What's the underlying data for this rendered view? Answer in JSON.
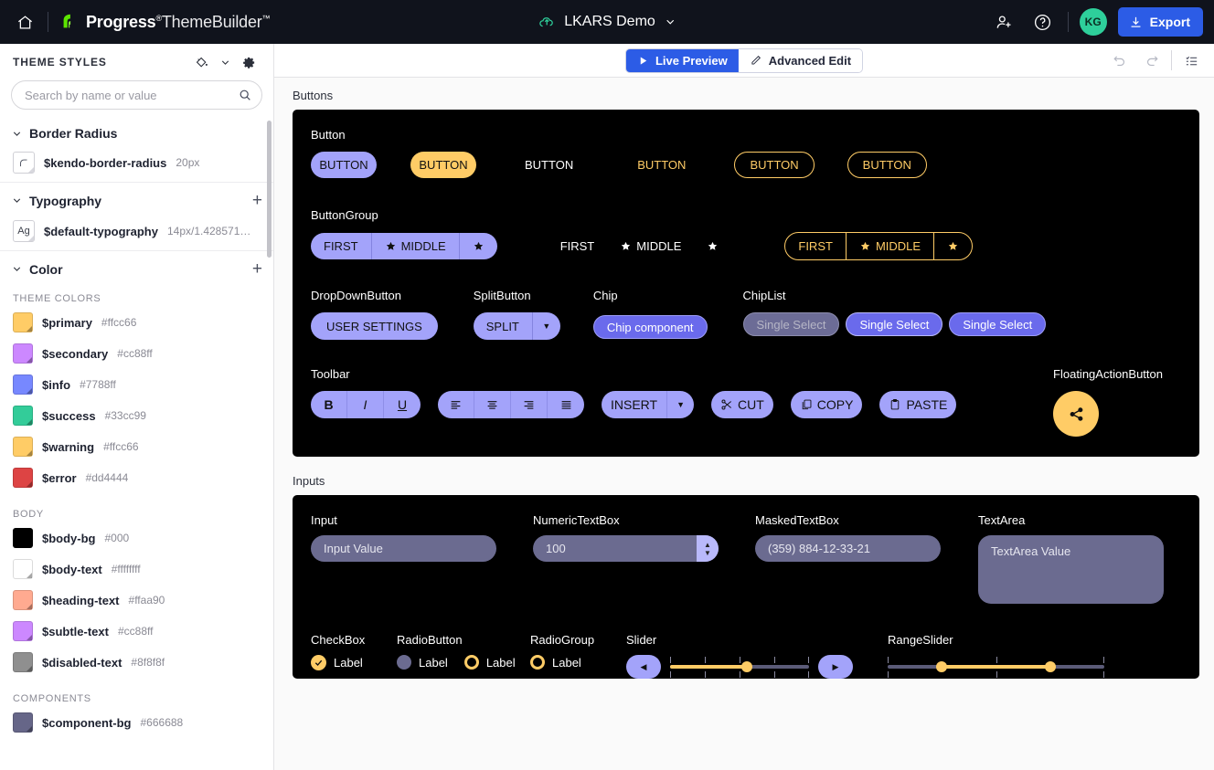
{
  "topbar": {
    "home_icon": "home-icon",
    "brand_bold": "Progress",
    "brand_light": "ThemeBuilder",
    "brand_tm": "™",
    "brand_reg": "®",
    "doc_title": "LKARS Demo",
    "cloud_icon": "cloud-upload-icon",
    "chevron_icon": "chevron-down-icon",
    "invite_icon": "add-user-icon",
    "help_icon": "help-circle-icon",
    "avatar_initials": "KG",
    "avatar_color": "#2ecf9b",
    "export_label": "Export",
    "export_icon": "download-icon",
    "export_color": "#2c5ce6"
  },
  "sidebar": {
    "title": "THEME STYLES",
    "paint_icon": "paint-bucket-icon",
    "chevron_icon": "chevron-down-icon",
    "gear_icon": "gear-icon",
    "search": {
      "placeholder": "Search by name or value",
      "value": "",
      "icon": "search-icon"
    },
    "sections": [
      {
        "name": "Border Radius",
        "has_plus": false,
        "tokens": [
          {
            "name": "$kendo-border-radius",
            "value": "20px",
            "swatch": "radius-preview"
          }
        ]
      },
      {
        "name": "Typography",
        "has_plus": true,
        "tokens": [
          {
            "name": "$default-typography",
            "value": "14px/1.428571…",
            "swatch": "Ag"
          }
        ]
      },
      {
        "name": "Color",
        "has_plus": true,
        "groups": [
          {
            "label": "THEME COLORS",
            "tokens": [
              {
                "name": "$primary",
                "value": "#ffcc66",
                "color": "#ffcc66"
              },
              {
                "name": "$secondary",
                "value": "#cc88ff",
                "color": "#cc88ff"
              },
              {
                "name": "$info",
                "value": "#7788ff",
                "color": "#7788ff"
              },
              {
                "name": "$success",
                "value": "#33cc99",
                "color": "#33cc99"
              },
              {
                "name": "$warning",
                "value": "#ffcc66",
                "color": "#ffcc66"
              },
              {
                "name": "$error",
                "value": "#dd4444",
                "color": "#dd4444"
              }
            ]
          },
          {
            "label": "BODY",
            "tokens": [
              {
                "name": "$body-bg",
                "value": "#000",
                "color": "#000000"
              },
              {
                "name": "$body-text",
                "value": "#ffffffff",
                "color": "#ffffff"
              },
              {
                "name": "$heading-text",
                "value": "#ffaa90",
                "color": "#ffaa90"
              },
              {
                "name": "$subtle-text",
                "value": "#cc88ff",
                "color": "#cc88ff"
              },
              {
                "name": "$disabled-text",
                "value": "#8f8f8f",
                "color": "#8f8f8f"
              }
            ]
          },
          {
            "label": "COMPONENTS",
            "tokens": [
              {
                "name": "$component-bg",
                "value": "#666688",
                "color": "#666688"
              }
            ]
          }
        ]
      }
    ]
  },
  "preview_bar": {
    "live_preview": "Live Preview",
    "live_preview_icon": "play-icon",
    "advanced_edit": "Advanced Edit",
    "advanced_edit_icon": "pencil-icon",
    "undo_icon": "undo-icon",
    "redo_icon": "redo-icon",
    "list_icon": "checklist-icon"
  },
  "canvas": {
    "buttons_panel": {
      "label": "Buttons",
      "button_row": {
        "label": "Button",
        "items": [
          {
            "text": "BUTTON",
            "variant": "primary"
          },
          {
            "text": "BUTTON",
            "variant": "warn"
          },
          {
            "text": "BUTTON",
            "variant": "flat"
          },
          {
            "text": "BUTTON",
            "variant": "link"
          },
          {
            "text": "BUTTON",
            "variant": "outline"
          },
          {
            "text": "BUTTON",
            "variant": "outline"
          }
        ]
      },
      "buttongroup_row": {
        "label": "ButtonGroup",
        "first": "FIRST",
        "middle": "MIDDLE",
        "star_icon": "star-icon"
      },
      "dropdownbutton": {
        "label": "DropDownButton",
        "text": "USER SETTINGS"
      },
      "splitbutton": {
        "label": "SplitButton",
        "text": "SPLIT",
        "arrow_icon": "caret-down-icon"
      },
      "chip": {
        "label": "Chip",
        "text": "Chip component"
      },
      "chiplist": {
        "label": "ChipList",
        "items": [
          {
            "text": "Single Select",
            "state": "disabled"
          },
          {
            "text": "Single Select",
            "state": "selected"
          },
          {
            "text": "Single Select",
            "state": "normal"
          }
        ]
      },
      "toolbar": {
        "label": "Toolbar",
        "bold": "B",
        "italic": "I",
        "underline": "U",
        "align_left_icon": "align-left-icon",
        "align_center_icon": "align-center-icon",
        "align_right_icon": "align-right-icon",
        "align_justify_icon": "align-justify-icon",
        "insert": "INSERT",
        "insert_arrow_icon": "caret-down-icon",
        "cut": "CUT",
        "cut_icon": "scissors-icon",
        "copy": "COPY",
        "copy_icon": "copy-icon",
        "paste": "PASTE",
        "paste_icon": "clipboard-icon"
      },
      "fab": {
        "label": "FloatingActionButton",
        "icon": "share-icon",
        "color": "#ffcc66"
      }
    },
    "inputs_panel": {
      "label": "Inputs",
      "input": {
        "label": "Input",
        "value": "Input Value"
      },
      "numeric": {
        "label": "NumericTextBox",
        "value": "100",
        "up_icon": "caret-up-icon",
        "down_icon": "caret-down-icon"
      },
      "masked": {
        "label": "MaskedTextBox",
        "value": "(359) 884-12-33-21"
      },
      "textarea": {
        "label": "TextArea",
        "value": "TextArea Value"
      },
      "checkbox": {
        "label": "CheckBox",
        "item_label": "Label",
        "check_icon": "check-icon"
      },
      "radiobutton": {
        "label": "RadioButton",
        "item1_label": "Label",
        "item2_label": "Label"
      },
      "radiogroup": {
        "label": "RadioGroup",
        "item_label": "Label"
      },
      "slider": {
        "label": "Slider",
        "value_pct": 55,
        "prev_icon": "caret-left-icon",
        "next_icon": "caret-right-icon"
      },
      "rangeslider": {
        "label": "RangeSlider",
        "start_pct": 25,
        "end_pct": 75
      }
    }
  }
}
